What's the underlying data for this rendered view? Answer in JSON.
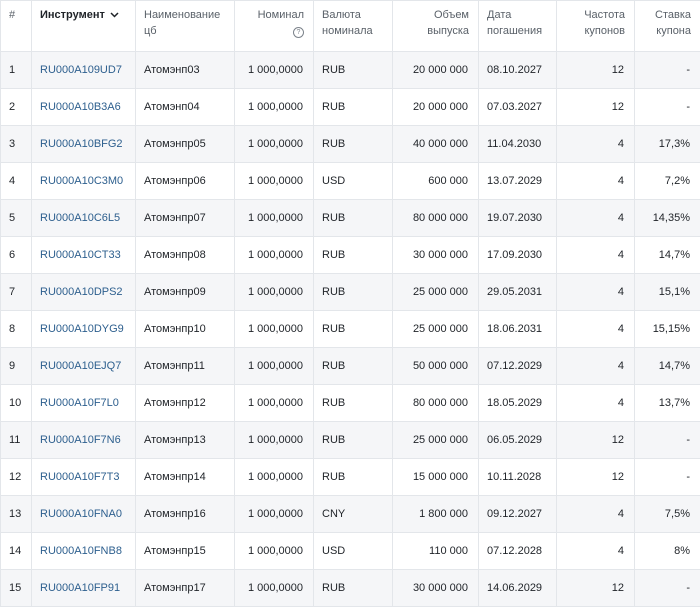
{
  "table": {
    "headers": {
      "num": "#",
      "instrument": "Инструмент",
      "name": [
        "Наименование",
        "цб"
      ],
      "nominal": "Номинал",
      "currency": [
        "Валюта",
        "номинала"
      ],
      "volume": [
        "Объем",
        "выпуска"
      ],
      "maturity": [
        "Дата",
        "погашения"
      ],
      "frequency": [
        "Частота",
        "купонов"
      ],
      "rate": [
        "Ставка",
        "купона"
      ]
    },
    "rows": [
      {
        "num": "1",
        "isin": "RU000A109UD7",
        "name": "Атомэнп03",
        "nominal": "1 000,0000",
        "currency": "RUB",
        "volume": "20 000 000",
        "maturity": "08.10.2027",
        "frequency": "12",
        "rate": "-"
      },
      {
        "num": "2",
        "isin": "RU000A10B3A6",
        "name": "Атомэнп04",
        "nominal": "1 000,0000",
        "currency": "RUB",
        "volume": "20 000 000",
        "maturity": "07.03.2027",
        "frequency": "12",
        "rate": "-"
      },
      {
        "num": "3",
        "isin": "RU000A10BFG2",
        "name": "Атомэнпр05",
        "nominal": "1 000,0000",
        "currency": "RUB",
        "volume": "40 000 000",
        "maturity": "11.04.2030",
        "frequency": "4",
        "rate": "17,3%"
      },
      {
        "num": "4",
        "isin": "RU000A10C3M0",
        "name": "Атомэнпр06",
        "nominal": "1 000,0000",
        "currency": "USD",
        "volume": "600 000",
        "maturity": "13.07.2029",
        "frequency": "4",
        "rate": "7,2%"
      },
      {
        "num": "5",
        "isin": "RU000A10C6L5",
        "name": "Атомэнпр07",
        "nominal": "1 000,0000",
        "currency": "RUB",
        "volume": "80 000 000",
        "maturity": "19.07.2030",
        "frequency": "4",
        "rate": "14,35%"
      },
      {
        "num": "6",
        "isin": "RU000A10CT33",
        "name": "Атомэнпр08",
        "nominal": "1 000,0000",
        "currency": "RUB",
        "volume": "30 000 000",
        "maturity": "17.09.2030",
        "frequency": "4",
        "rate": "14,7%"
      },
      {
        "num": "7",
        "isin": "RU000A10DPS2",
        "name": "Атомэнпр09",
        "nominal": "1 000,0000",
        "currency": "RUB",
        "volume": "25 000 000",
        "maturity": "29.05.2031",
        "frequency": "4",
        "rate": "15,1%"
      },
      {
        "num": "8",
        "isin": "RU000A10DYG9",
        "name": "Атомэнпр10",
        "nominal": "1 000,0000",
        "currency": "RUB",
        "volume": "25 000 000",
        "maturity": "18.06.2031",
        "frequency": "4",
        "rate": "15,15%"
      },
      {
        "num": "9",
        "isin": "RU000A10EJQ7",
        "name": "Атомэнпр11",
        "nominal": "1 000,0000",
        "currency": "RUB",
        "volume": "50 000 000",
        "maturity": "07.12.2029",
        "frequency": "4",
        "rate": "14,7%"
      },
      {
        "num": "10",
        "isin": "RU000A10F7L0",
        "name": "Атомэнпр12",
        "nominal": "1 000,0000",
        "currency": "RUB",
        "volume": "80 000 000",
        "maturity": "18.05.2029",
        "frequency": "4",
        "rate": "13,7%"
      },
      {
        "num": "11",
        "isin": "RU000A10F7N6",
        "name": "Атомэнпр13",
        "nominal": "1 000,0000",
        "currency": "RUB",
        "volume": "25 000 000",
        "maturity": "06.05.2029",
        "frequency": "12",
        "rate": "-"
      },
      {
        "num": "12",
        "isin": "RU000A10F7T3",
        "name": "Атомэнпр14",
        "nominal": "1 000,0000",
        "currency": "RUB",
        "volume": "15 000 000",
        "maturity": "10.11.2028",
        "frequency": "12",
        "rate": "-"
      },
      {
        "num": "13",
        "isin": "RU000A10FNA0",
        "name": "Атомэнпр16",
        "nominal": "1 000,0000",
        "currency": "CNY",
        "volume": "1 800 000",
        "maturity": "09.12.2027",
        "frequency": "4",
        "rate": "7,5%"
      },
      {
        "num": "14",
        "isin": "RU000A10FNB8",
        "name": "Атомэнпр15",
        "nominal": "1 000,0000",
        "currency": "USD",
        "volume": "110 000",
        "maturity": "07.12.2028",
        "frequency": "4",
        "rate": "8%"
      },
      {
        "num": "15",
        "isin": "RU000A10FP91",
        "name": "Атомэнпр17",
        "nominal": "1 000,0000",
        "currency": "RUB",
        "volume": "30 000 000",
        "maturity": "14.06.2029",
        "frequency": "12",
        "rate": "-"
      }
    ]
  },
  "icons": {
    "sort": "chevron-down-icon",
    "help": "question-circle-icon"
  },
  "colors": {
    "link": "#2d5f8e",
    "stripe": "#f5f6f8",
    "border": "#e3e6ea"
  }
}
